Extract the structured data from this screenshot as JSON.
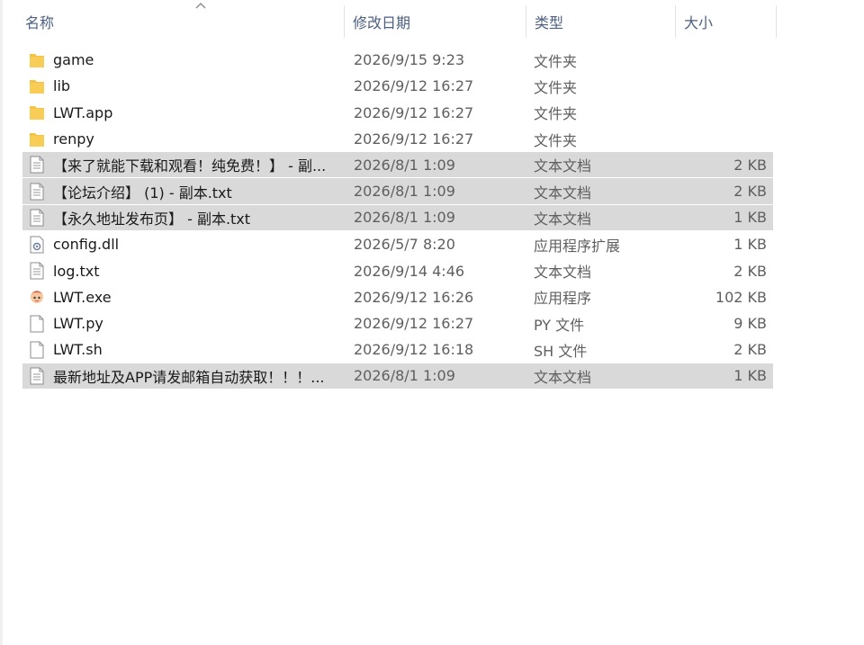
{
  "header": {
    "name": "名称",
    "date": "修改日期",
    "type": "类型",
    "size": "大小"
  },
  "colors": {
    "folder": "#f3c343",
    "selected_row": "#d9d9d9",
    "header_text": "#4d6082"
  },
  "files": [
    {
      "name": "game",
      "date": "2026/9/15 9:23",
      "type": "文件夹",
      "size": "",
      "icon": "folder-icon",
      "selected": false
    },
    {
      "name": "lib",
      "date": "2026/9/12 16:27",
      "type": "文件夹",
      "size": "",
      "icon": "folder-icon",
      "selected": false
    },
    {
      "name": "LWT.app",
      "date": "2026/9/12 16:27",
      "type": "文件夹",
      "size": "",
      "icon": "folder-icon",
      "selected": false
    },
    {
      "name": "renpy",
      "date": "2026/9/12 16:27",
      "type": "文件夹",
      "size": "",
      "icon": "folder-icon",
      "selected": false
    },
    {
      "name": "【来了就能下载和观看！纯免费！】 - 副...",
      "date": "2026/8/1 1:09",
      "type": "文本文档",
      "size": "2 KB",
      "icon": "text-file-icon",
      "selected": true
    },
    {
      "name": "【论坛介绍】 (1) - 副本.txt",
      "date": "2026/8/1 1:09",
      "type": "文本文档",
      "size": "2 KB",
      "icon": "text-file-icon",
      "selected": true
    },
    {
      "name": "【永久地址发布页】 - 副本.txt",
      "date": "2026/8/1 1:09",
      "type": "文本文档",
      "size": "1 KB",
      "icon": "text-file-icon",
      "selected": true
    },
    {
      "name": "config.dll",
      "date": "2026/5/7 8:20",
      "type": "应用程序扩展",
      "size": "1 KB",
      "icon": "dll-file-icon",
      "selected": false
    },
    {
      "name": "log.txt",
      "date": "2026/9/14 4:46",
      "type": "文本文档",
      "size": "2 KB",
      "icon": "text-file-icon",
      "selected": false
    },
    {
      "name": "LWT.exe",
      "date": "2026/9/12 16:26",
      "type": "应用程序",
      "size": "102 KB",
      "icon": "app-exe-icon",
      "selected": false
    },
    {
      "name": "LWT.py",
      "date": "2026/9/12 16:27",
      "type": "PY 文件",
      "size": "9 KB",
      "icon": "blank-file-icon",
      "selected": false
    },
    {
      "name": "LWT.sh",
      "date": "2026/9/12 16:18",
      "type": "SH 文件",
      "size": "2 KB",
      "icon": "blank-file-icon",
      "selected": false
    },
    {
      "name": "最新地址及APP请发邮箱自动获取！！！...",
      "date": "2026/8/1 1:09",
      "type": "文本文档",
      "size": "1 KB",
      "icon": "text-file-icon",
      "selected": true
    }
  ]
}
